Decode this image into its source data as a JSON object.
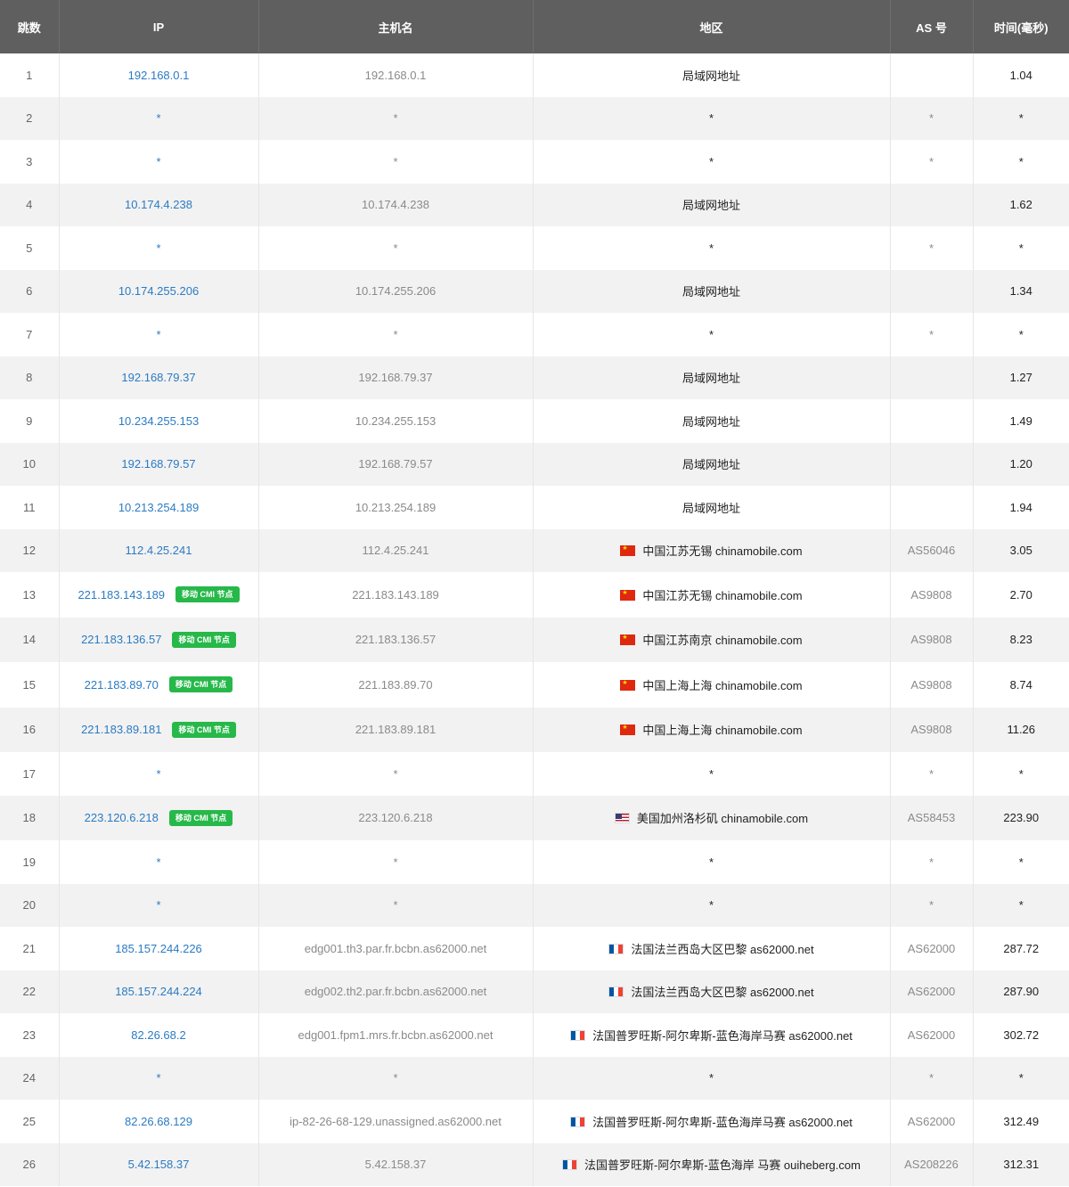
{
  "headers": [
    "跳数",
    "IP",
    "主机名",
    "地区",
    "AS 号",
    "时间(毫秒)"
  ],
  "badge_label": "移动 CMI 节点",
  "colors": {
    "header_bg": "#5f5f5f",
    "ip_link": "#2b7bc3",
    "badge_bg": "#27b84a",
    "row_alt": "#f2f2f2"
  },
  "rows": [
    {
      "hop": "1",
      "ip": "192.168.0.1",
      "badge": false,
      "host": "192.168.0.1",
      "flag": "",
      "region": "局域网地址",
      "asn": "",
      "time": "1.04"
    },
    {
      "hop": "2",
      "ip": "*",
      "badge": false,
      "host": "*",
      "flag": "",
      "region": "*",
      "asn": "*",
      "time": "*"
    },
    {
      "hop": "3",
      "ip": "*",
      "badge": false,
      "host": "*",
      "flag": "",
      "region": "*",
      "asn": "*",
      "time": "*"
    },
    {
      "hop": "4",
      "ip": "10.174.4.238",
      "badge": false,
      "host": "10.174.4.238",
      "flag": "",
      "region": "局域网地址",
      "asn": "",
      "time": "1.62"
    },
    {
      "hop": "5",
      "ip": "*",
      "badge": false,
      "host": "*",
      "flag": "",
      "region": "*",
      "asn": "*",
      "time": "*"
    },
    {
      "hop": "6",
      "ip": "10.174.255.206",
      "badge": false,
      "host": "10.174.255.206",
      "flag": "",
      "region": "局域网地址",
      "asn": "",
      "time": "1.34"
    },
    {
      "hop": "7",
      "ip": "*",
      "badge": false,
      "host": "*",
      "flag": "",
      "region": "*",
      "asn": "*",
      "time": "*"
    },
    {
      "hop": "8",
      "ip": "192.168.79.37",
      "badge": false,
      "host": "192.168.79.37",
      "flag": "",
      "region": "局域网地址",
      "asn": "",
      "time": "1.27"
    },
    {
      "hop": "9",
      "ip": "10.234.255.153",
      "badge": false,
      "host": "10.234.255.153",
      "flag": "",
      "region": "局域网地址",
      "asn": "",
      "time": "1.49"
    },
    {
      "hop": "10",
      "ip": "192.168.79.57",
      "badge": false,
      "host": "192.168.79.57",
      "flag": "",
      "region": "局域网地址",
      "asn": "",
      "time": "1.20"
    },
    {
      "hop": "11",
      "ip": "10.213.254.189",
      "badge": false,
      "host": "10.213.254.189",
      "flag": "",
      "region": "局域网地址",
      "asn": "",
      "time": "1.94"
    },
    {
      "hop": "12",
      "ip": "112.4.25.241",
      "badge": false,
      "host": "112.4.25.241",
      "flag": "cn",
      "region": "中国江苏无锡 chinamobile.com",
      "asn": "AS56046",
      "time": "3.05"
    },
    {
      "hop": "13",
      "ip": "221.183.143.189",
      "badge": true,
      "host": "221.183.143.189",
      "flag": "cn",
      "region": "中国江苏无锡 chinamobile.com",
      "asn": "AS9808",
      "time": "2.70"
    },
    {
      "hop": "14",
      "ip": "221.183.136.57",
      "badge": true,
      "host": "221.183.136.57",
      "flag": "cn",
      "region": "中国江苏南京 chinamobile.com",
      "asn": "AS9808",
      "time": "8.23"
    },
    {
      "hop": "15",
      "ip": "221.183.89.70",
      "badge": true,
      "host": "221.183.89.70",
      "flag": "cn",
      "region": "中国上海上海 chinamobile.com",
      "asn": "AS9808",
      "time": "8.74"
    },
    {
      "hop": "16",
      "ip": "221.183.89.181",
      "badge": true,
      "host": "221.183.89.181",
      "flag": "cn",
      "region": "中国上海上海 chinamobile.com",
      "asn": "AS9808",
      "time": "11.26"
    },
    {
      "hop": "17",
      "ip": "*",
      "badge": false,
      "host": "*",
      "flag": "",
      "region": "*",
      "asn": "*",
      "time": "*"
    },
    {
      "hop": "18",
      "ip": "223.120.6.218",
      "badge": true,
      "host": "223.120.6.218",
      "flag": "us",
      "region": "美国加州洛杉矶 chinamobile.com",
      "asn": "AS58453",
      "time": "223.90"
    },
    {
      "hop": "19",
      "ip": "*",
      "badge": false,
      "host": "*",
      "flag": "",
      "region": "*",
      "asn": "*",
      "time": "*"
    },
    {
      "hop": "20",
      "ip": "*",
      "badge": false,
      "host": "*",
      "flag": "",
      "region": "*",
      "asn": "*",
      "time": "*"
    },
    {
      "hop": "21",
      "ip": "185.157.244.226",
      "badge": false,
      "host": "edg001.th3.par.fr.bcbn.as62000.net",
      "flag": "fr",
      "region": "法国法兰西岛大区巴黎 as62000.net",
      "asn": "AS62000",
      "time": "287.72"
    },
    {
      "hop": "22",
      "ip": "185.157.244.224",
      "badge": false,
      "host": "edg002.th2.par.fr.bcbn.as62000.net",
      "flag": "fr",
      "region": "法国法兰西岛大区巴黎 as62000.net",
      "asn": "AS62000",
      "time": "287.90"
    },
    {
      "hop": "23",
      "ip": "82.26.68.2",
      "badge": false,
      "host": "edg001.fpm1.mrs.fr.bcbn.as62000.net",
      "flag": "fr",
      "region": "法国普罗旺斯-阿尔卑斯-蓝色海岸马赛 as62000.net",
      "asn": "AS62000",
      "time": "302.72"
    },
    {
      "hop": "24",
      "ip": "*",
      "badge": false,
      "host": "*",
      "flag": "",
      "region": "*",
      "asn": "*",
      "time": "*"
    },
    {
      "hop": "25",
      "ip": "82.26.68.129",
      "badge": false,
      "host": "ip-82-26-68-129.unassigned.as62000.net",
      "flag": "fr",
      "region": "法国普罗旺斯-阿尔卑斯-蓝色海岸马赛 as62000.net",
      "asn": "AS62000",
      "time": "312.49"
    },
    {
      "hop": "26",
      "ip": "5.42.158.37",
      "badge": false,
      "host": "5.42.158.37",
      "flag": "fr",
      "region": "法国普罗旺斯-阿尔卑斯-蓝色海岸 马赛 ouiheberg.com",
      "asn": "AS208226",
      "time": "312.31"
    }
  ]
}
